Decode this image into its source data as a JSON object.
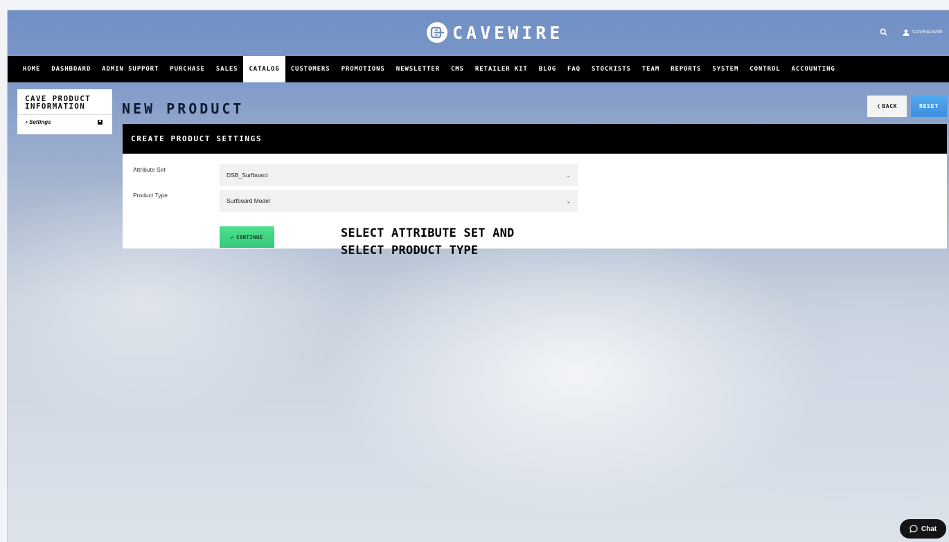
{
  "brand": {
    "name": "CAVEWIRE",
    "logo_icon": "cavewire-logo-icon"
  },
  "header": {
    "user_label": "CAVEADMIN",
    "search_icon": "search-icon",
    "user_icon": "user-icon"
  },
  "nav": {
    "items": [
      "HOME",
      "DASHBOARD",
      "ADMIN SUPPORT",
      "PURCHASE",
      "SALES",
      "CATALOG",
      "CUSTOMERS",
      "PROMOTIONS",
      "NEWSLETTER",
      "CMS",
      "RETAILER KIT",
      "BLOG",
      "FAQ",
      "STOCKISTS",
      "TEAM",
      "REPORTS",
      "SYSTEM",
      "CONTROL",
      "ACCOUNTING"
    ],
    "active": "CATALOG"
  },
  "sidebar": {
    "title_line1": "CAVE PRODUCT",
    "title_line2": "INFORMATION",
    "items": [
      {
        "label": "• Settings",
        "icon": "save-icon"
      }
    ]
  },
  "page": {
    "title": "NEW PRODUCT",
    "back_label": "BACK",
    "reset_label": "RESET"
  },
  "panel": {
    "header": "CREATE PRODUCT SETTINGS",
    "attribute_set": {
      "label": "Attribute Set",
      "value": "DSB_Surfboard"
    },
    "product_type": {
      "label": "Product Type",
      "value": "Surfboard Model"
    },
    "continue_label": "CONTINUE",
    "note_line1": "SELECT ATTRIBUTE SET AND",
    "note_line2": "SELECT PRODUCT TYPE"
  },
  "chat": {
    "label": "Chat",
    "icon": "chat-bubble-icon"
  },
  "colors": {
    "nav_bg": "#000000",
    "reset_bg": "#3f8fe0",
    "continue_bg": "#35c878"
  }
}
